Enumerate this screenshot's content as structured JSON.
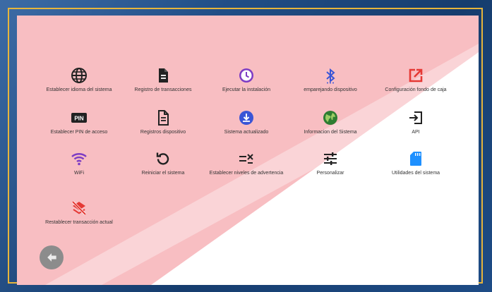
{
  "colors": {
    "frame": "#1f4e86",
    "gold_border": "#e7b53b",
    "screen_bg": "#ffffff",
    "watermark": "#f5a3a8",
    "icon_dark": "#222222",
    "icon_purple": "#7d3cc4",
    "icon_blue": "#3a55d6",
    "icon_red": "#e53935",
    "icon_green": "#2e7d32",
    "icon_sky": "#1e90ff",
    "back_button": "#8c8c8c"
  },
  "menu": [
    {
      "label": "Establecer idioma del sistema",
      "icon": "globe-icon"
    },
    {
      "label": "Registro de transacciones",
      "icon": "document-icon"
    },
    {
      "label": "Ejecutar la instalación",
      "icon": "clock-icon"
    },
    {
      "label": "emparejando dispositivo",
      "icon": "bluetooth-icon"
    },
    {
      "label": "Configuración fondo de caja",
      "icon": "edit-external-icon"
    },
    {
      "label": "Establecer PIN de acceso",
      "icon": "pin-icon"
    },
    {
      "label": "Registros dispositivo",
      "icon": "document-outline-icon"
    },
    {
      "label": "Sistema actualizado",
      "icon": "download-circle-icon"
    },
    {
      "label": "Informacion del Sistema",
      "icon": "globe-green-icon"
    },
    {
      "label": "API",
      "icon": "login-icon"
    },
    {
      "label": "WiFi",
      "icon": "wifi-icon"
    },
    {
      "label": "Reiniciar el sistema",
      "icon": "restart-icon"
    },
    {
      "label": "Establecer niveles de advertencia",
      "icon": "checklist-icon"
    },
    {
      "label": "Personalizar",
      "icon": "tune-icon"
    },
    {
      "label": "Utilidades del sistema",
      "icon": "sd-card-icon"
    },
    {
      "label": "Restablecer transacción actual",
      "icon": "layers-off-icon"
    }
  ],
  "back_button": {
    "icon": "back-arrow-icon"
  }
}
